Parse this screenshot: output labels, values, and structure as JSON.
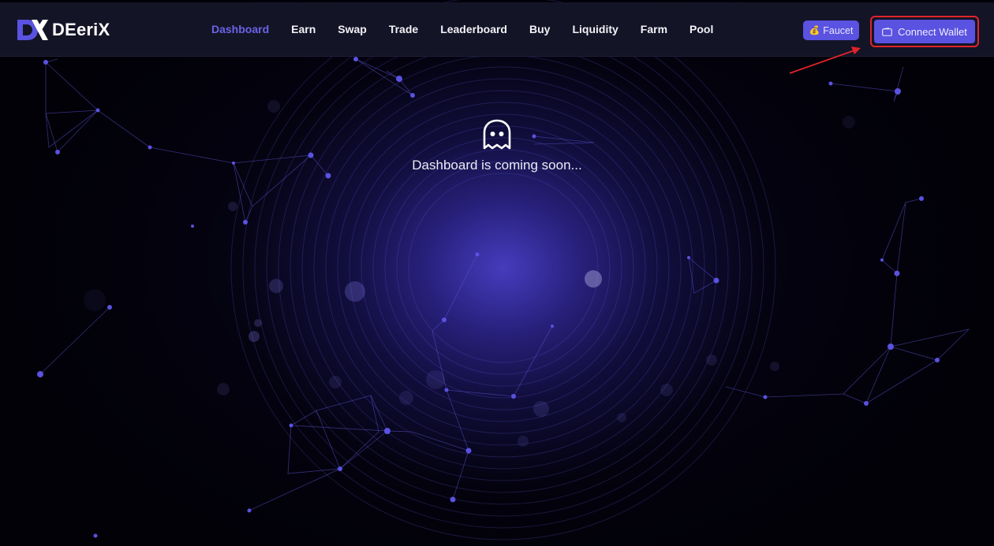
{
  "app": {
    "brand": "DEeriX"
  },
  "nav": {
    "items": [
      {
        "label": "Dashboard",
        "active": true
      },
      {
        "label": "Earn",
        "active": false
      },
      {
        "label": "Swap",
        "active": false
      },
      {
        "label": "Trade",
        "active": false
      },
      {
        "label": "Leaderboard",
        "active": false
      },
      {
        "label": "Buy",
        "active": false
      },
      {
        "label": "Liquidity",
        "active": false
      },
      {
        "label": "Farm",
        "active": false
      },
      {
        "label": "Pool",
        "active": false
      }
    ]
  },
  "actions": {
    "faucet_label": "Faucet",
    "faucet_icon": "money-bag-icon",
    "connect_wallet_label": "Connect Wallet",
    "connect_wallet_icon": "wallet-icon"
  },
  "main": {
    "icon": "ghost-icon",
    "message": "Dashboard is coming soon..."
  },
  "colors": {
    "accent": "#5a52e0",
    "active_nav": "#6a63e6",
    "header_bg": "#141427",
    "highlight": "#e0242a"
  }
}
